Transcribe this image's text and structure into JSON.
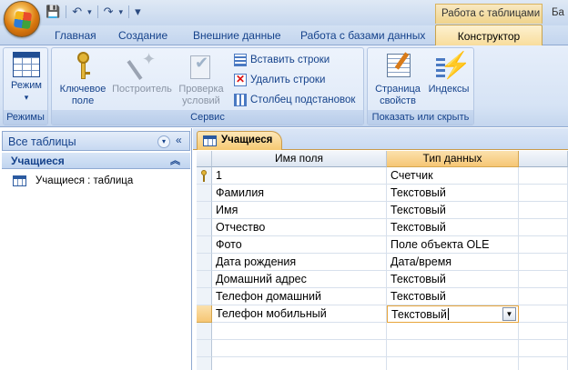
{
  "qat": {
    "save": "💾",
    "undo": "↶",
    "redo": "↷",
    "customize": "▾"
  },
  "context_tab_title": "Работа с таблицами",
  "title_right": "Ба",
  "tabs": [
    "Главная",
    "Создание",
    "Внешние данные",
    "Работа с базами данных",
    "Конструктор"
  ],
  "ribbon": {
    "groups": {
      "modes": "Режимы",
      "service": "Сервис",
      "show_hide": "Показать или скрыть"
    },
    "view_btn": [
      "Режим",
      "▾"
    ],
    "key_btn": [
      "Ключевое",
      "поле"
    ],
    "builder_btn": "Построитель",
    "test_btn": [
      "Проверка",
      "условий"
    ],
    "insert_rows": "Вставить строки",
    "delete_rows": "Удалить строки",
    "lookup_col": "Столбец  подстановок",
    "props_btn": [
      "Страница",
      "свойств"
    ],
    "index_btn": "Индексы"
  },
  "nav": {
    "header": "Все таблицы",
    "dropdown": "▾",
    "collapse": "«",
    "group": "Учащиеся",
    "group_chevron": "⌃",
    "item": "Учащиеся : таблица"
  },
  "doc_tab": "Учащиеся",
  "grid": {
    "col_field": "Имя поля",
    "col_type": "Тип данных",
    "rows": [
      {
        "field": "1",
        "type": "Счетчик",
        "key": true
      },
      {
        "field": "Фамилия",
        "type": "Текстовый"
      },
      {
        "field": "Имя",
        "type": "Текстовый"
      },
      {
        "field": "Отчество",
        "type": "Текстовый"
      },
      {
        "field": "Фото",
        "type": "Поле объекта OLE"
      },
      {
        "field": "Дата рождения",
        "type": "Дата/время"
      },
      {
        "field": "Домашний адрес",
        "type": "Текстовый"
      },
      {
        "field": "Телефон домашний",
        "type": "Текстовый"
      },
      {
        "field": "Телефон мобильный",
        "type": "Текстовый",
        "editing": true
      }
    ],
    "dropdown_arrow": "▼"
  }
}
